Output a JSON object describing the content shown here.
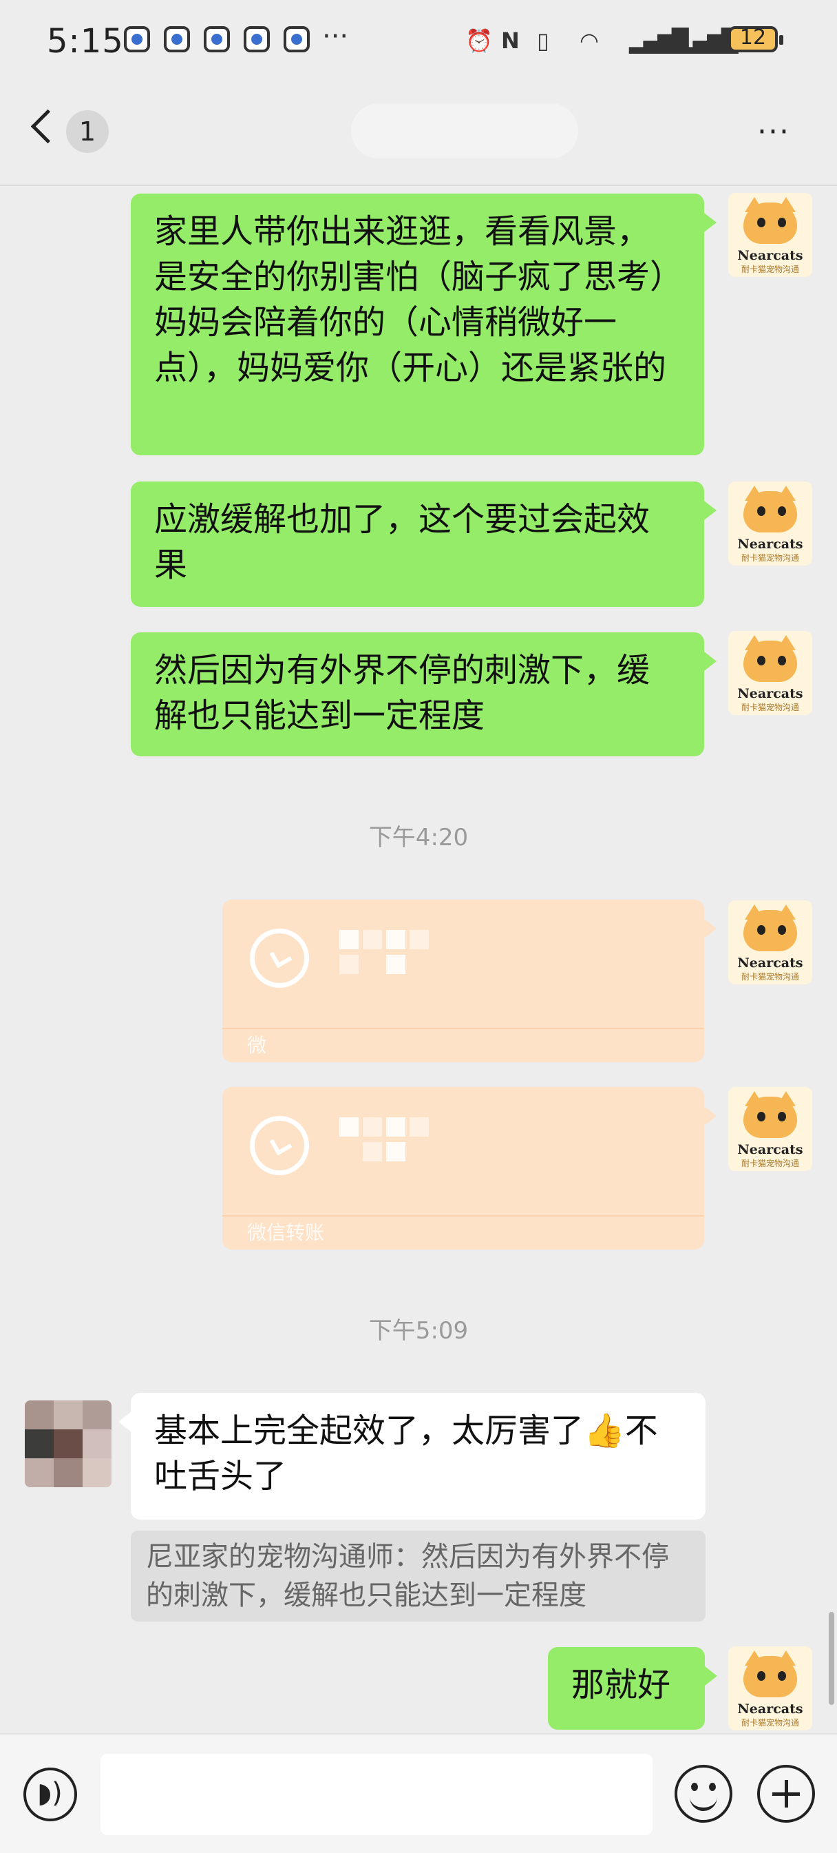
{
  "status_bar": {
    "time": "5:15",
    "overflow": "···",
    "battery": "12"
  },
  "header": {
    "unread_count": "1",
    "more": "···"
  },
  "messages": [
    {
      "side": "out",
      "text": "家里人带你出来逛逛，看看风景，是安全的你别害怕（脑子疯了思考）妈妈会陪着你的（心情稍微好一点），妈妈爱你（开心）还是紧张的"
    },
    {
      "side": "out",
      "text": "应激缓解也加了，这个要过会起效果"
    },
    {
      "side": "out",
      "text": "然后因为有外界不停的刺激下，缓解也只能达到一定程度"
    },
    {
      "type": "time",
      "text": "下午4:20"
    },
    {
      "type": "time",
      "text": "下午5:09"
    },
    {
      "side": "in",
      "text": "基本上完全起效了，太厉害了👍不吐舌头了"
    },
    {
      "side": "out",
      "text": "那就好"
    }
  ],
  "transfers": [
    {
      "label": "微"
    },
    {
      "label": "微信转账"
    }
  ],
  "quote": {
    "text": "尼亚家的宠物沟通师：然后因为有外界不停的刺激下，缓解也只能达到一定程度"
  },
  "avatar_cat": {
    "brand": "Nearcats",
    "sub": "耐卡猫宠物沟通"
  },
  "input_bar": {
    "voice_glyph": "◗)"
  }
}
